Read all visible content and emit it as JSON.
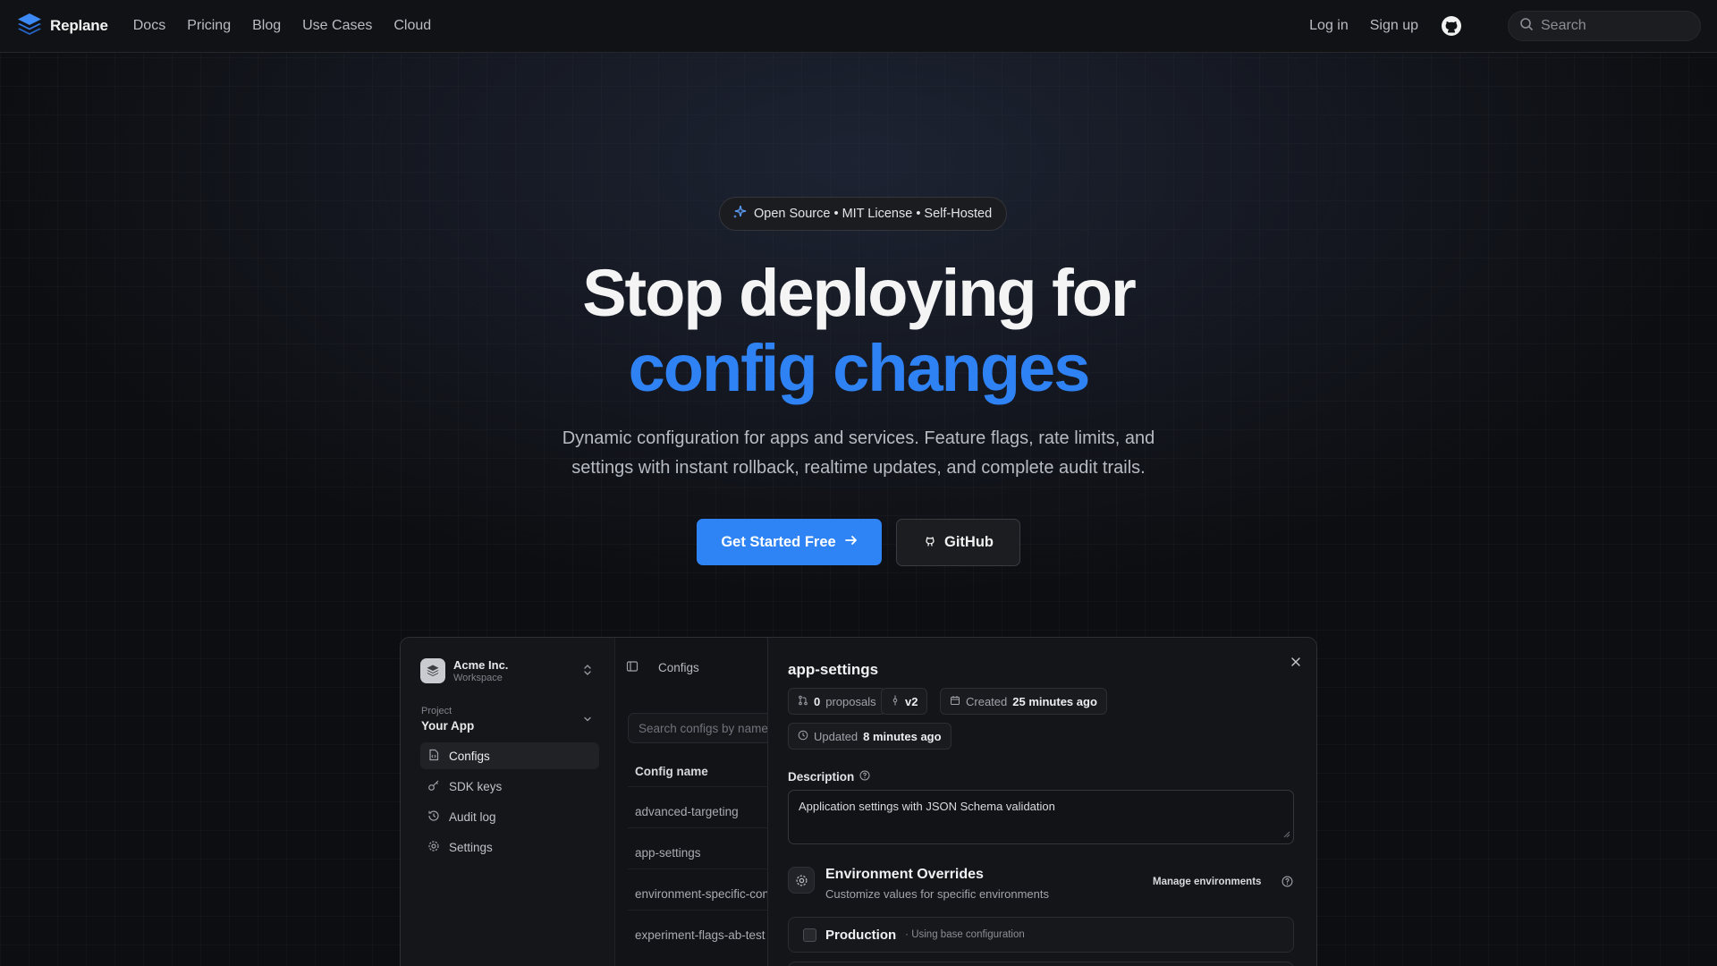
{
  "nav": {
    "brand": "Replane",
    "links": [
      "Docs",
      "Pricing",
      "Blog",
      "Use Cases",
      "Cloud"
    ],
    "login": "Log in",
    "signup": "Sign up",
    "search_placeholder": "Search"
  },
  "hero": {
    "badge": "Open Source • MIT License • Self-Hosted",
    "headline_line1": "Stop deploying for",
    "headline_line2": "config changes",
    "subtitle": "Dynamic configuration for apps and services. Feature flags, rate limits, and settings with instant rollback, realtime updates, and complete audit trails.",
    "primary_cta": "Get Started Free",
    "secondary_cta": "GitHub"
  },
  "preview": {
    "workspace": {
      "name": "Acme Inc.",
      "subtitle": "Workspace"
    },
    "project": {
      "label": "Project",
      "name": "Your App"
    },
    "sidebar_items": [
      {
        "label": "Configs",
        "icon": "file-code-icon",
        "active": true
      },
      {
        "label": "SDK keys",
        "icon": "key-icon",
        "active": false
      },
      {
        "label": "Audit log",
        "icon": "history-icon",
        "active": false
      },
      {
        "label": "Settings",
        "icon": "gear-icon",
        "active": false
      }
    ],
    "configs": {
      "title": "Configs",
      "search_placeholder": "Search configs by name",
      "column_header": "Config name",
      "rows": [
        "advanced-targeting",
        "app-settings",
        "environment-specific-config",
        "experiment-flags-ab-test"
      ]
    },
    "detail": {
      "title": "app-settings",
      "proposals_count": "0",
      "proposals_label": "proposals",
      "version": "v2",
      "created_label": "Created",
      "created_value": "25 minutes ago",
      "updated_label": "Updated",
      "updated_value": "8 minutes ago",
      "description_label": "Description",
      "description_value": "Application settings with JSON Schema validation",
      "env_title": "Environment Overrides",
      "env_subtitle": "Customize values for specific environments",
      "manage_label": "Manage environments",
      "env_rows": [
        {
          "name": "Production",
          "note": "· Using base configuration"
        }
      ]
    }
  },
  "colors": {
    "accent": "#2f84f5",
    "background": "#0d0e11"
  }
}
